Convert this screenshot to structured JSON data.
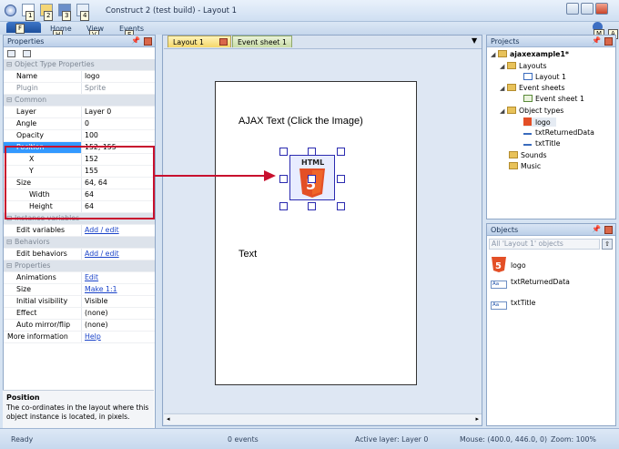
{
  "app": {
    "title": "Construct 2 (test build) - Layout 1",
    "keytips": [
      "1",
      "2",
      "3",
      "4",
      "F",
      "H",
      "V",
      "E",
      "M",
      "A"
    ]
  },
  "ribbon": {
    "tabs": [
      "Home",
      "View",
      "Events"
    ]
  },
  "properties": {
    "title": "Properties",
    "sections": {
      "object_type": "Object Type Properties",
      "common": "Common",
      "instance_variables": "Instance variables",
      "behaviors": "Behaviors",
      "properties": "Properties"
    },
    "rows": {
      "name": {
        "label": "Name",
        "value": "logo"
      },
      "plugin": {
        "label": "Plugin",
        "value": "Sprite"
      },
      "layer": {
        "label": "Layer",
        "value": "Layer 0"
      },
      "angle": {
        "label": "Angle",
        "value": "0"
      },
      "opacity": {
        "label": "Opacity",
        "value": "100"
      },
      "position": {
        "label": "Position",
        "value": "152, 155"
      },
      "x": {
        "label": "X",
        "value": "152"
      },
      "y": {
        "label": "Y",
        "value": "155"
      },
      "size": {
        "label": "Size",
        "value": "64, 64"
      },
      "width": {
        "label": "Width",
        "value": "64"
      },
      "height": {
        "label": "Height",
        "value": "64"
      },
      "edit_variables": {
        "label": "Edit variables",
        "value": "Add / edit"
      },
      "edit_behaviors": {
        "label": "Edit behaviors",
        "value": "Add / edit"
      },
      "animations": {
        "label": "Animations",
        "value": "Edit"
      },
      "size2": {
        "label": "Size",
        "value": "Make 1:1"
      },
      "initial_visibility": {
        "label": "Initial visibility",
        "value": "Visible"
      },
      "effect": {
        "label": "Effect",
        "value": "(none)"
      },
      "auto_mirror": {
        "label": "Auto mirror/flip",
        "value": "(none)"
      },
      "more_info": {
        "label": "More information",
        "value": "Help"
      }
    },
    "description": {
      "title": "Position",
      "text": "The co-ordinates in the layout where this object instance is located, in pixels."
    }
  },
  "editor": {
    "tabs": [
      "Layout 1",
      "Event sheet 1"
    ],
    "canvas_texts": {
      "ajax": "AJAX Text (Click the Image)",
      "text": "Text"
    },
    "logo_text": "HTML"
  },
  "projects": {
    "title": "Projects",
    "root": "ajaxexample1*",
    "layouts": "Layouts",
    "layout1": "Layout 1",
    "event_sheets": "Event sheets",
    "event_sheet1": "Event sheet 1",
    "object_types": "Object types",
    "logo": "logo",
    "txt_returned": "txtReturnedData",
    "txt_title": "txtTitle",
    "sounds": "Sounds",
    "music": "Music"
  },
  "objects": {
    "title": "Objects",
    "filter": "All 'Layout 1' objects",
    "items": [
      "logo",
      "txtReturnedData",
      "txtTitle"
    ],
    "txt_icon_label": "Aa"
  },
  "status": {
    "ready": "Ready",
    "events": "0 events",
    "active_layer": "Active layer: Layer 0",
    "mouse": "Mouse: (400.0, 446.0, 0)",
    "zoom": "Zoom: 100%"
  },
  "colors": {
    "accent_red": "#c8102e",
    "selection_blue": "#3399ff",
    "html5_orange": "#e34f26"
  }
}
